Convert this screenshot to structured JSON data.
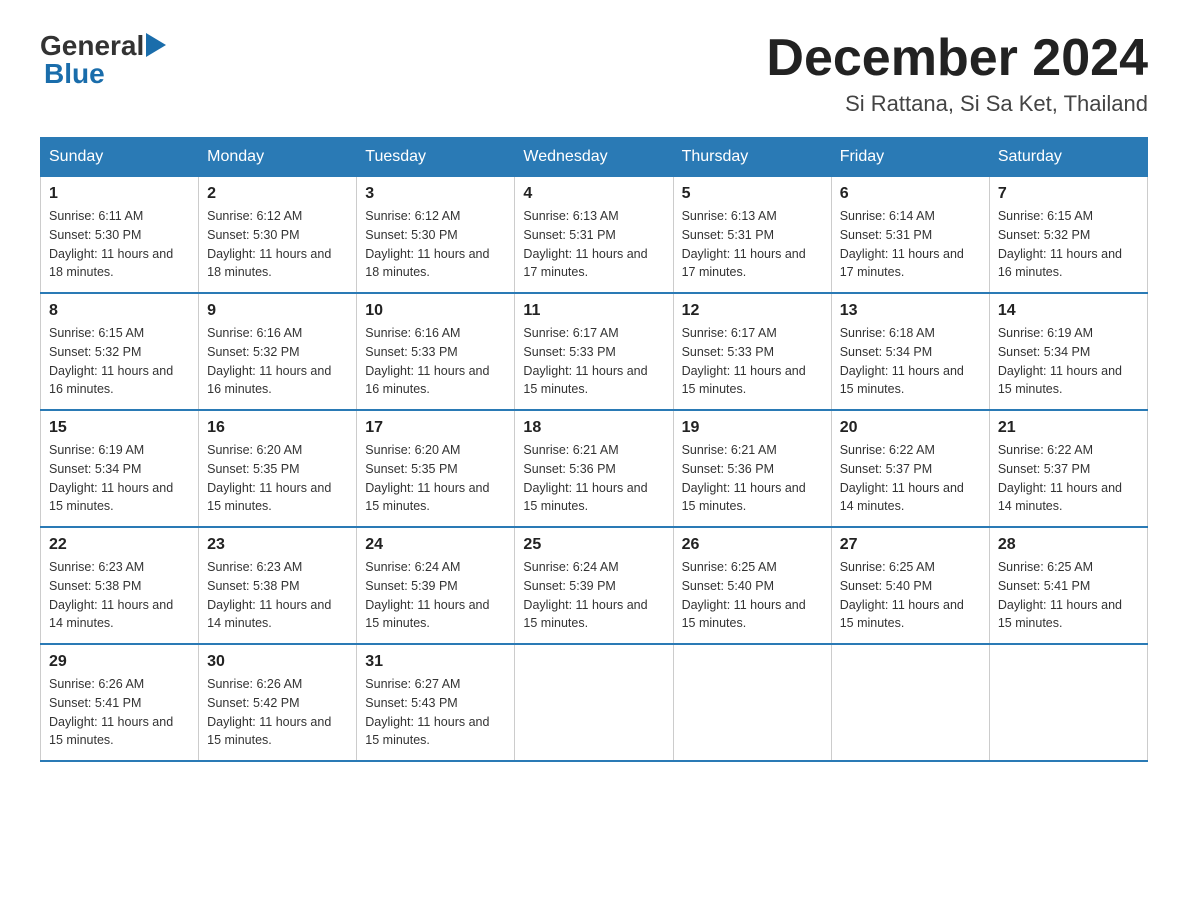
{
  "logo": {
    "general": "General",
    "blue": "Blue",
    "triangle": "▶"
  },
  "title": "December 2024",
  "subtitle": "Si Rattana, Si Sa Ket, Thailand",
  "days_of_week": [
    "Sunday",
    "Monday",
    "Tuesday",
    "Wednesday",
    "Thursday",
    "Friday",
    "Saturday"
  ],
  "weeks": [
    [
      {
        "day": "1",
        "sunrise": "6:11 AM",
        "sunset": "5:30 PM",
        "daylight": "11 hours and 18 minutes."
      },
      {
        "day": "2",
        "sunrise": "6:12 AM",
        "sunset": "5:30 PM",
        "daylight": "11 hours and 18 minutes."
      },
      {
        "day": "3",
        "sunrise": "6:12 AM",
        "sunset": "5:30 PM",
        "daylight": "11 hours and 18 minutes."
      },
      {
        "day": "4",
        "sunrise": "6:13 AM",
        "sunset": "5:31 PM",
        "daylight": "11 hours and 17 minutes."
      },
      {
        "day": "5",
        "sunrise": "6:13 AM",
        "sunset": "5:31 PM",
        "daylight": "11 hours and 17 minutes."
      },
      {
        "day": "6",
        "sunrise": "6:14 AM",
        "sunset": "5:31 PM",
        "daylight": "11 hours and 17 minutes."
      },
      {
        "day": "7",
        "sunrise": "6:15 AM",
        "sunset": "5:32 PM",
        "daylight": "11 hours and 16 minutes."
      }
    ],
    [
      {
        "day": "8",
        "sunrise": "6:15 AM",
        "sunset": "5:32 PM",
        "daylight": "11 hours and 16 minutes."
      },
      {
        "day": "9",
        "sunrise": "6:16 AM",
        "sunset": "5:32 PM",
        "daylight": "11 hours and 16 minutes."
      },
      {
        "day": "10",
        "sunrise": "6:16 AM",
        "sunset": "5:33 PM",
        "daylight": "11 hours and 16 minutes."
      },
      {
        "day": "11",
        "sunrise": "6:17 AM",
        "sunset": "5:33 PM",
        "daylight": "11 hours and 15 minutes."
      },
      {
        "day": "12",
        "sunrise": "6:17 AM",
        "sunset": "5:33 PM",
        "daylight": "11 hours and 15 minutes."
      },
      {
        "day": "13",
        "sunrise": "6:18 AM",
        "sunset": "5:34 PM",
        "daylight": "11 hours and 15 minutes."
      },
      {
        "day": "14",
        "sunrise": "6:19 AM",
        "sunset": "5:34 PM",
        "daylight": "11 hours and 15 minutes."
      }
    ],
    [
      {
        "day": "15",
        "sunrise": "6:19 AM",
        "sunset": "5:34 PM",
        "daylight": "11 hours and 15 minutes."
      },
      {
        "day": "16",
        "sunrise": "6:20 AM",
        "sunset": "5:35 PM",
        "daylight": "11 hours and 15 minutes."
      },
      {
        "day": "17",
        "sunrise": "6:20 AM",
        "sunset": "5:35 PM",
        "daylight": "11 hours and 15 minutes."
      },
      {
        "day": "18",
        "sunrise": "6:21 AM",
        "sunset": "5:36 PM",
        "daylight": "11 hours and 15 minutes."
      },
      {
        "day": "19",
        "sunrise": "6:21 AM",
        "sunset": "5:36 PM",
        "daylight": "11 hours and 15 minutes."
      },
      {
        "day": "20",
        "sunrise": "6:22 AM",
        "sunset": "5:37 PM",
        "daylight": "11 hours and 14 minutes."
      },
      {
        "day": "21",
        "sunrise": "6:22 AM",
        "sunset": "5:37 PM",
        "daylight": "11 hours and 14 minutes."
      }
    ],
    [
      {
        "day": "22",
        "sunrise": "6:23 AM",
        "sunset": "5:38 PM",
        "daylight": "11 hours and 14 minutes."
      },
      {
        "day": "23",
        "sunrise": "6:23 AM",
        "sunset": "5:38 PM",
        "daylight": "11 hours and 14 minutes."
      },
      {
        "day": "24",
        "sunrise": "6:24 AM",
        "sunset": "5:39 PM",
        "daylight": "11 hours and 15 minutes."
      },
      {
        "day": "25",
        "sunrise": "6:24 AM",
        "sunset": "5:39 PM",
        "daylight": "11 hours and 15 minutes."
      },
      {
        "day": "26",
        "sunrise": "6:25 AM",
        "sunset": "5:40 PM",
        "daylight": "11 hours and 15 minutes."
      },
      {
        "day": "27",
        "sunrise": "6:25 AM",
        "sunset": "5:40 PM",
        "daylight": "11 hours and 15 minutes."
      },
      {
        "day": "28",
        "sunrise": "6:25 AM",
        "sunset": "5:41 PM",
        "daylight": "11 hours and 15 minutes."
      }
    ],
    [
      {
        "day": "29",
        "sunrise": "6:26 AM",
        "sunset": "5:41 PM",
        "daylight": "11 hours and 15 minutes."
      },
      {
        "day": "30",
        "sunrise": "6:26 AM",
        "sunset": "5:42 PM",
        "daylight": "11 hours and 15 minutes."
      },
      {
        "day": "31",
        "sunrise": "6:27 AM",
        "sunset": "5:43 PM",
        "daylight": "11 hours and 15 minutes."
      },
      null,
      null,
      null,
      null
    ]
  ]
}
